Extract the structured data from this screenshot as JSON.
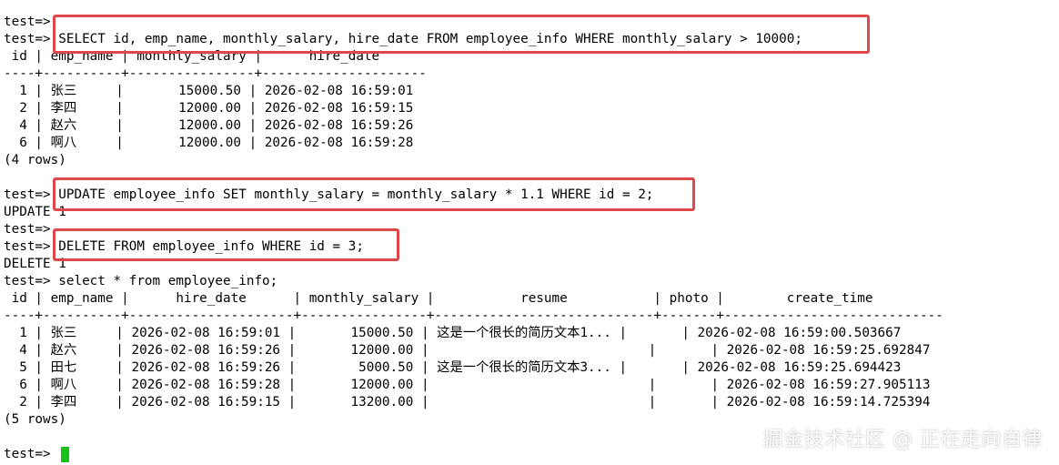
{
  "terminal": {
    "lines": [
      "test=>",
      "test=> SELECT id, emp_name, monthly_salary, hire_date FROM employee_info WHERE monthly_salary > 10000;",
      " id | emp_name | monthly_salary |      hire_date",
      "----+----------+----------------+---------------------",
      "  1 | 张三     |       15000.50 | 2026-02-08 16:59:01",
      "  2 | 李四     |       12000.00 | 2026-02-08 16:59:15",
      "  4 | 赵六     |       12000.00 | 2026-02-08 16:59:26",
      "  6 | 啊八     |       12000.00 | 2026-02-08 16:59:28",
      "(4 rows)",
      "",
      "test=> UPDATE employee_info SET monthly_salary = monthly_salary * 1.1 WHERE id = 2;",
      "UPDATE 1",
      "test=>",
      "test=> DELETE FROM employee_info WHERE id = 3;",
      "DELETE 1",
      "test=> select * from employee_info;",
      " id | emp_name |      hire_date      | monthly_salary |           resume           | photo |        create_time",
      "----+----------+---------------------+----------------+----------------------------+-------+----------------------------",
      "  1 | 张三     | 2026-02-08 16:59:01 |       15000.50 | 这是一个很长的简历文本1... |       | 2026-02-08 16:59:00.503667",
      "  4 | 赵六     | 2026-02-08 16:59:26 |       12000.00 |                            |       | 2026-02-08 16:59:25.692847",
      "  5 | 田七     | 2026-02-08 16:59:26 |        5000.50 | 这是一个很长的简历文本3... |       | 2026-02-08 16:59:25.694423",
      "  6 | 啊八     | 2026-02-08 16:59:28 |       12000.00 |                            |       | 2026-02-08 16:59:27.905113",
      "  2 | 李四     | 2026-02-08 16:59:15 |       13200.00 |                            |       | 2026-02-08 16:59:14.725394",
      "(5 rows)",
      "",
      "test=> "
    ],
    "cursor_color": "#18c318",
    "highlight_color": "#e0474b"
  },
  "watermark": "掘金技术社区 @ 正在走向自律"
}
